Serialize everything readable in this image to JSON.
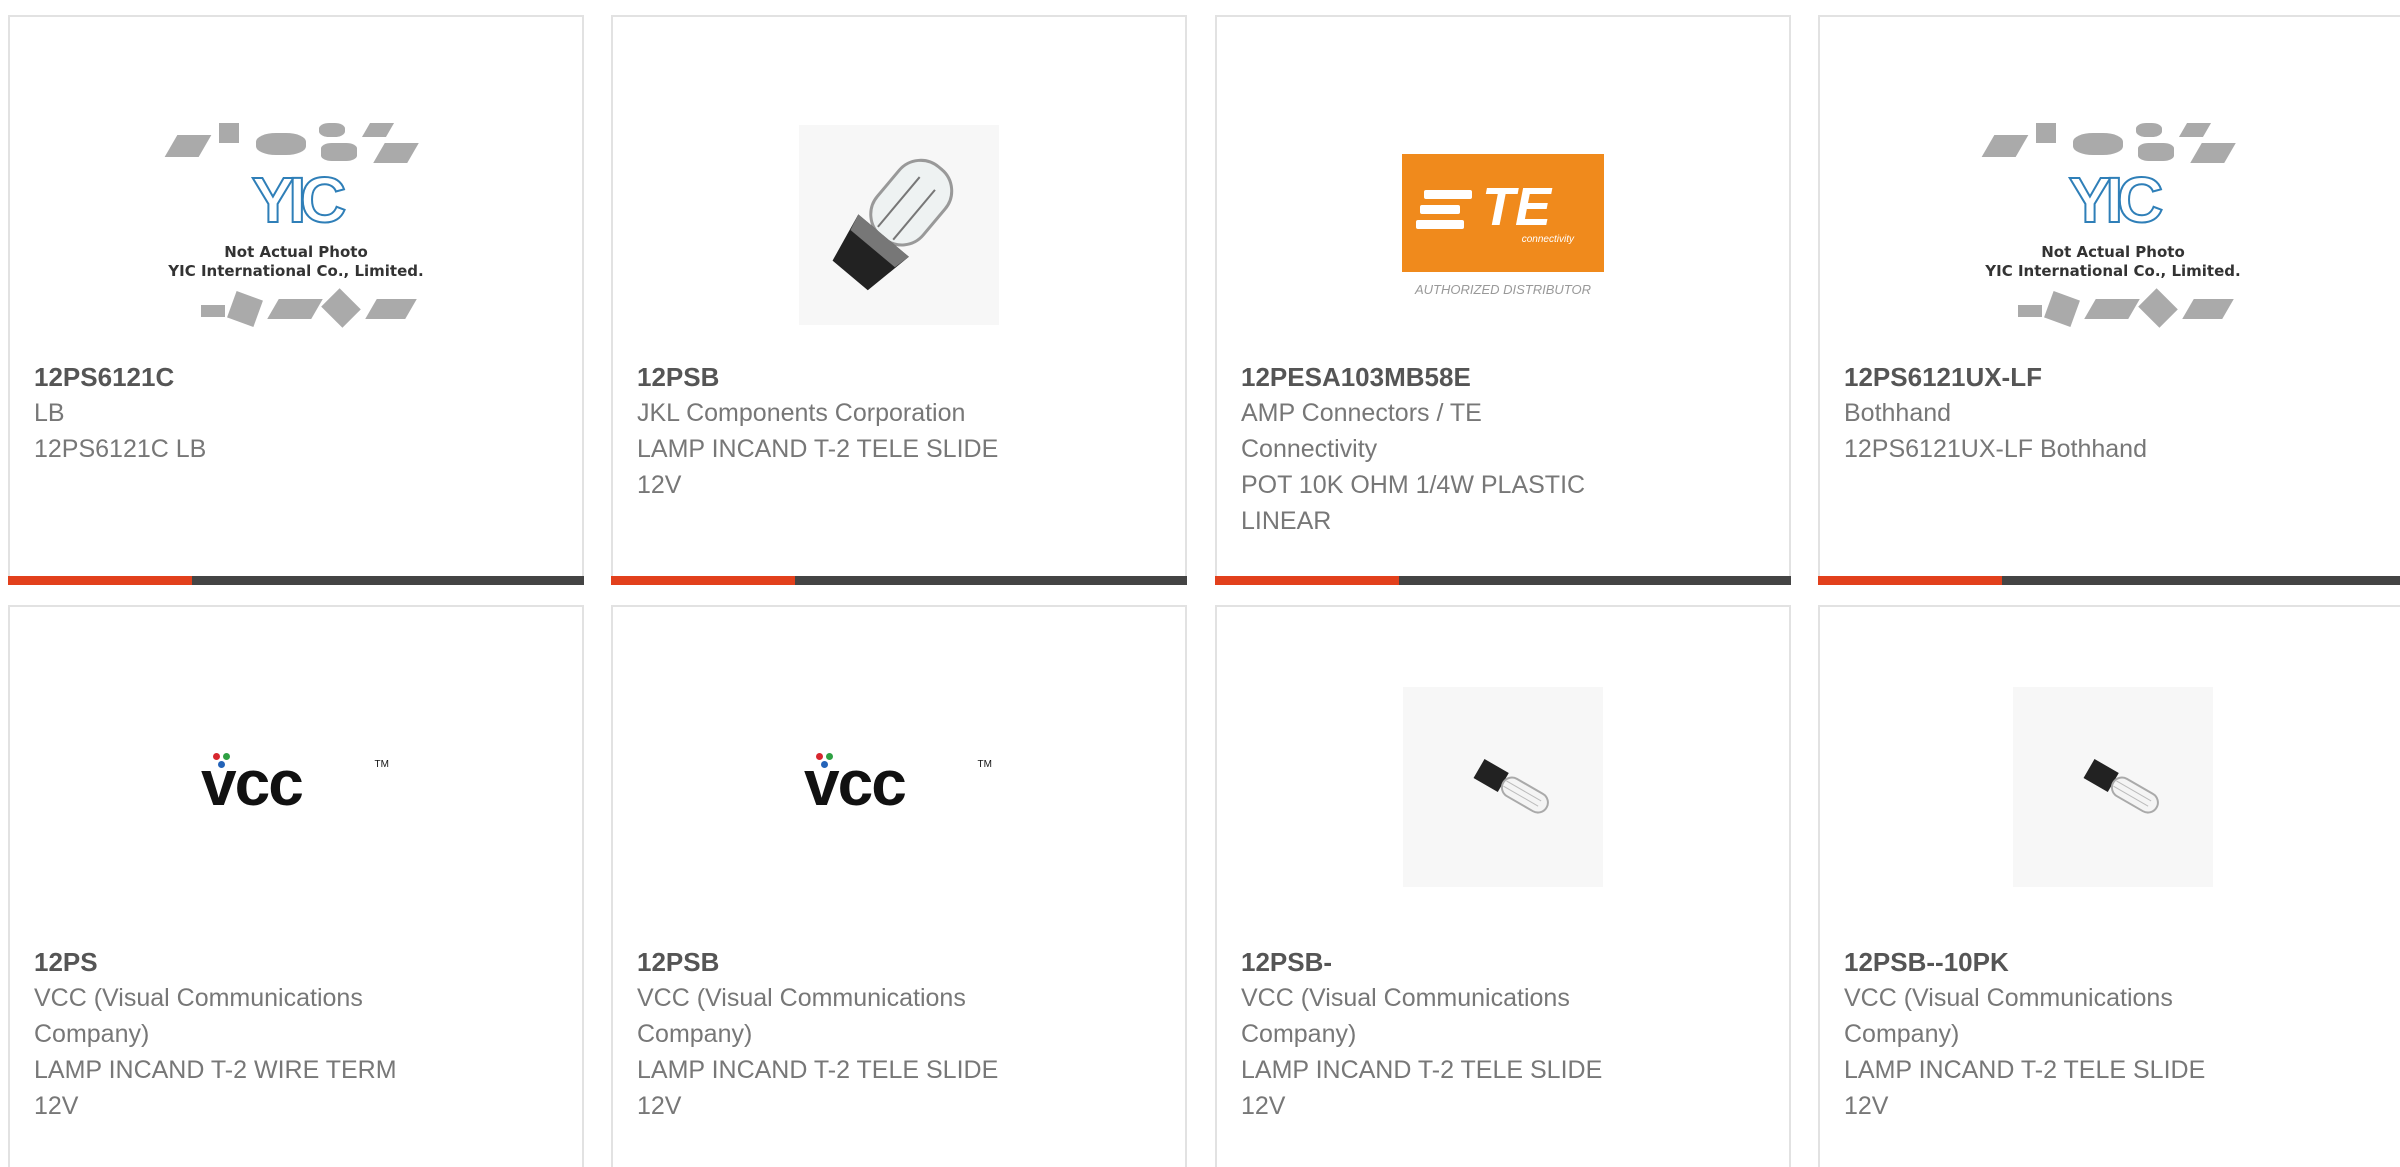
{
  "products": [
    {
      "part": "12PS6121C",
      "lines": [
        "LB",
        "12PS6121C LB"
      ],
      "image": "yic-placeholder",
      "image_text": [
        "Not Actual Photo",
        "YIC International Co., Limited."
      ]
    },
    {
      "part": "12PSB",
      "lines": [
        "JKL Components Corporation",
        "LAMP INCAND T-2 TELE SLIDE",
        "12V"
      ],
      "image": "lamp-bulb-photo"
    },
    {
      "part": "12PESA103MB58E",
      "lines": [
        "AMP Connectors / TE",
        "Connectivity",
        "POT 10K OHM 1/4W PLASTIC",
        "LINEAR"
      ],
      "image": "te-logo",
      "image_text": [
        "TE",
        "connectivity",
        "AUTHORIZED DISTRIBUTOR"
      ]
    },
    {
      "part": "12PS6121UX-LF",
      "lines": [
        "Bothhand",
        "12PS6121UX-LF Bothhand"
      ],
      "image": "yic-placeholder",
      "image_text": [
        "Not Actual Photo",
        "YIC International Co., Limited."
      ]
    },
    {
      "part": "12PS",
      "lines": [
        "VCC (Visual Communications",
        "Company)",
        "LAMP INCAND T-2 WIRE TERM",
        "12V"
      ],
      "image": "vcc-logo",
      "image_text": [
        "vcc",
        "TM"
      ]
    },
    {
      "part": "12PSB",
      "lines": [
        "VCC (Visual Communications",
        "Company)",
        "LAMP INCAND T-2 TELE SLIDE",
        "12V"
      ],
      "image": "vcc-logo",
      "image_text": [
        "vcc",
        "TM"
      ]
    },
    {
      "part": "12PSB-",
      "lines": [
        "VCC (Visual Communications",
        "Company)",
        "LAMP INCAND T-2 TELE SLIDE",
        "12V"
      ],
      "image": "lamp-small-photo"
    },
    {
      "part": "12PSB--10PK",
      "lines": [
        "VCC (Visual Communications",
        "Company)",
        "LAMP INCAND T-2 TELE SLIDE",
        "12V"
      ],
      "image": "lamp-small-photo"
    }
  ],
  "colors": {
    "accent_red": "#e2401c",
    "accent_dark": "#444444",
    "text_gray": "#777777",
    "part_number": "#555555",
    "te_orange": "#f08a1c",
    "yic_blue": "#2f7fb8"
  }
}
